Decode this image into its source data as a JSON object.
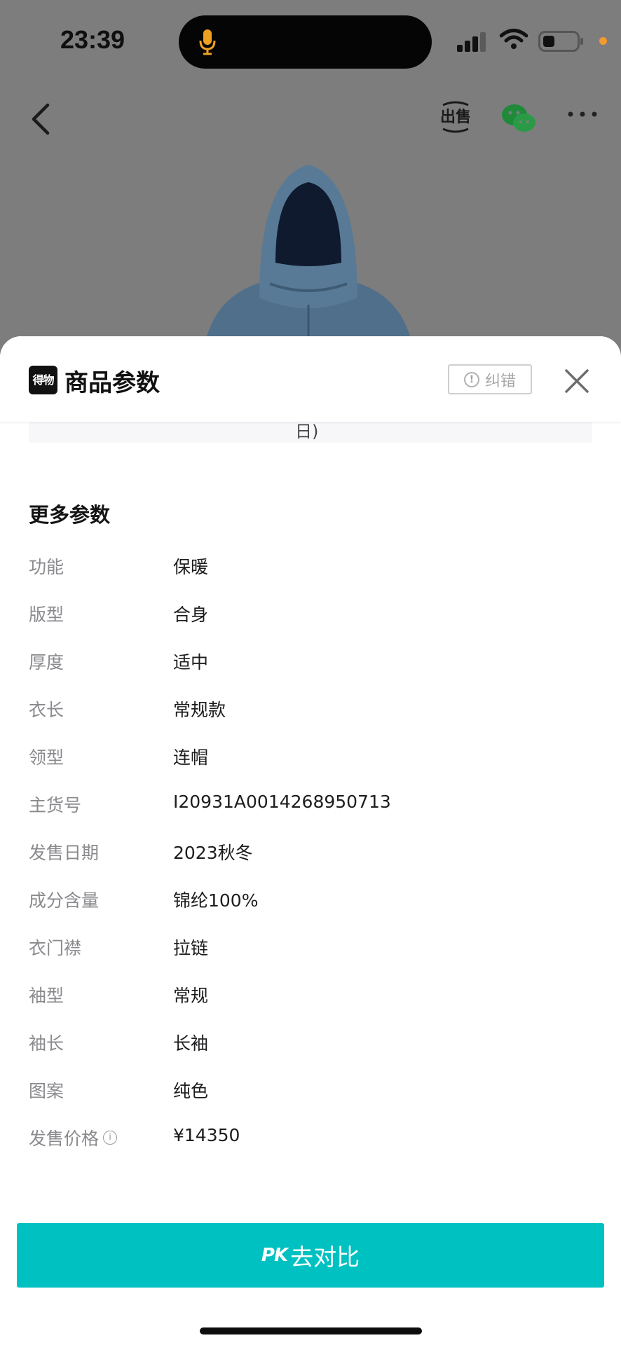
{
  "status_bar": {
    "time": "23:39"
  },
  "nav": {
    "sell_label": "出售"
  },
  "sheet": {
    "brand_logo": "得物",
    "title": "商品参数",
    "correct_label": "纠错",
    "cut_text": "日)"
  },
  "more_params": {
    "title": "更多参数",
    "rows": [
      {
        "key": "功能",
        "value": "保暖"
      },
      {
        "key": "版型",
        "value": "合身"
      },
      {
        "key": "厚度",
        "value": "适中"
      },
      {
        "key": "衣长",
        "value": "常规款"
      },
      {
        "key": "领型",
        "value": "连帽"
      },
      {
        "key": "主货号",
        "value": "I20931A0014268950713"
      },
      {
        "key": "发售日期",
        "value": "2023秋冬"
      },
      {
        "key": "成分含量",
        "value": "锦纶100%"
      },
      {
        "key": "衣门襟",
        "value": "拉链"
      },
      {
        "key": "袖型",
        "value": "常规"
      },
      {
        "key": "袖长",
        "value": "长袖"
      },
      {
        "key": "图案",
        "value": "纯色"
      },
      {
        "key": "发售价格",
        "value": "¥14350"
      }
    ]
  },
  "pk_button": {
    "prefix": "PK",
    "label": "去对比"
  },
  "colors": {
    "accent": "#00c1c1",
    "overlay": "#7d7d7d",
    "key_text": "#8a8a8e",
    "value_text": "#1d1d1f"
  }
}
